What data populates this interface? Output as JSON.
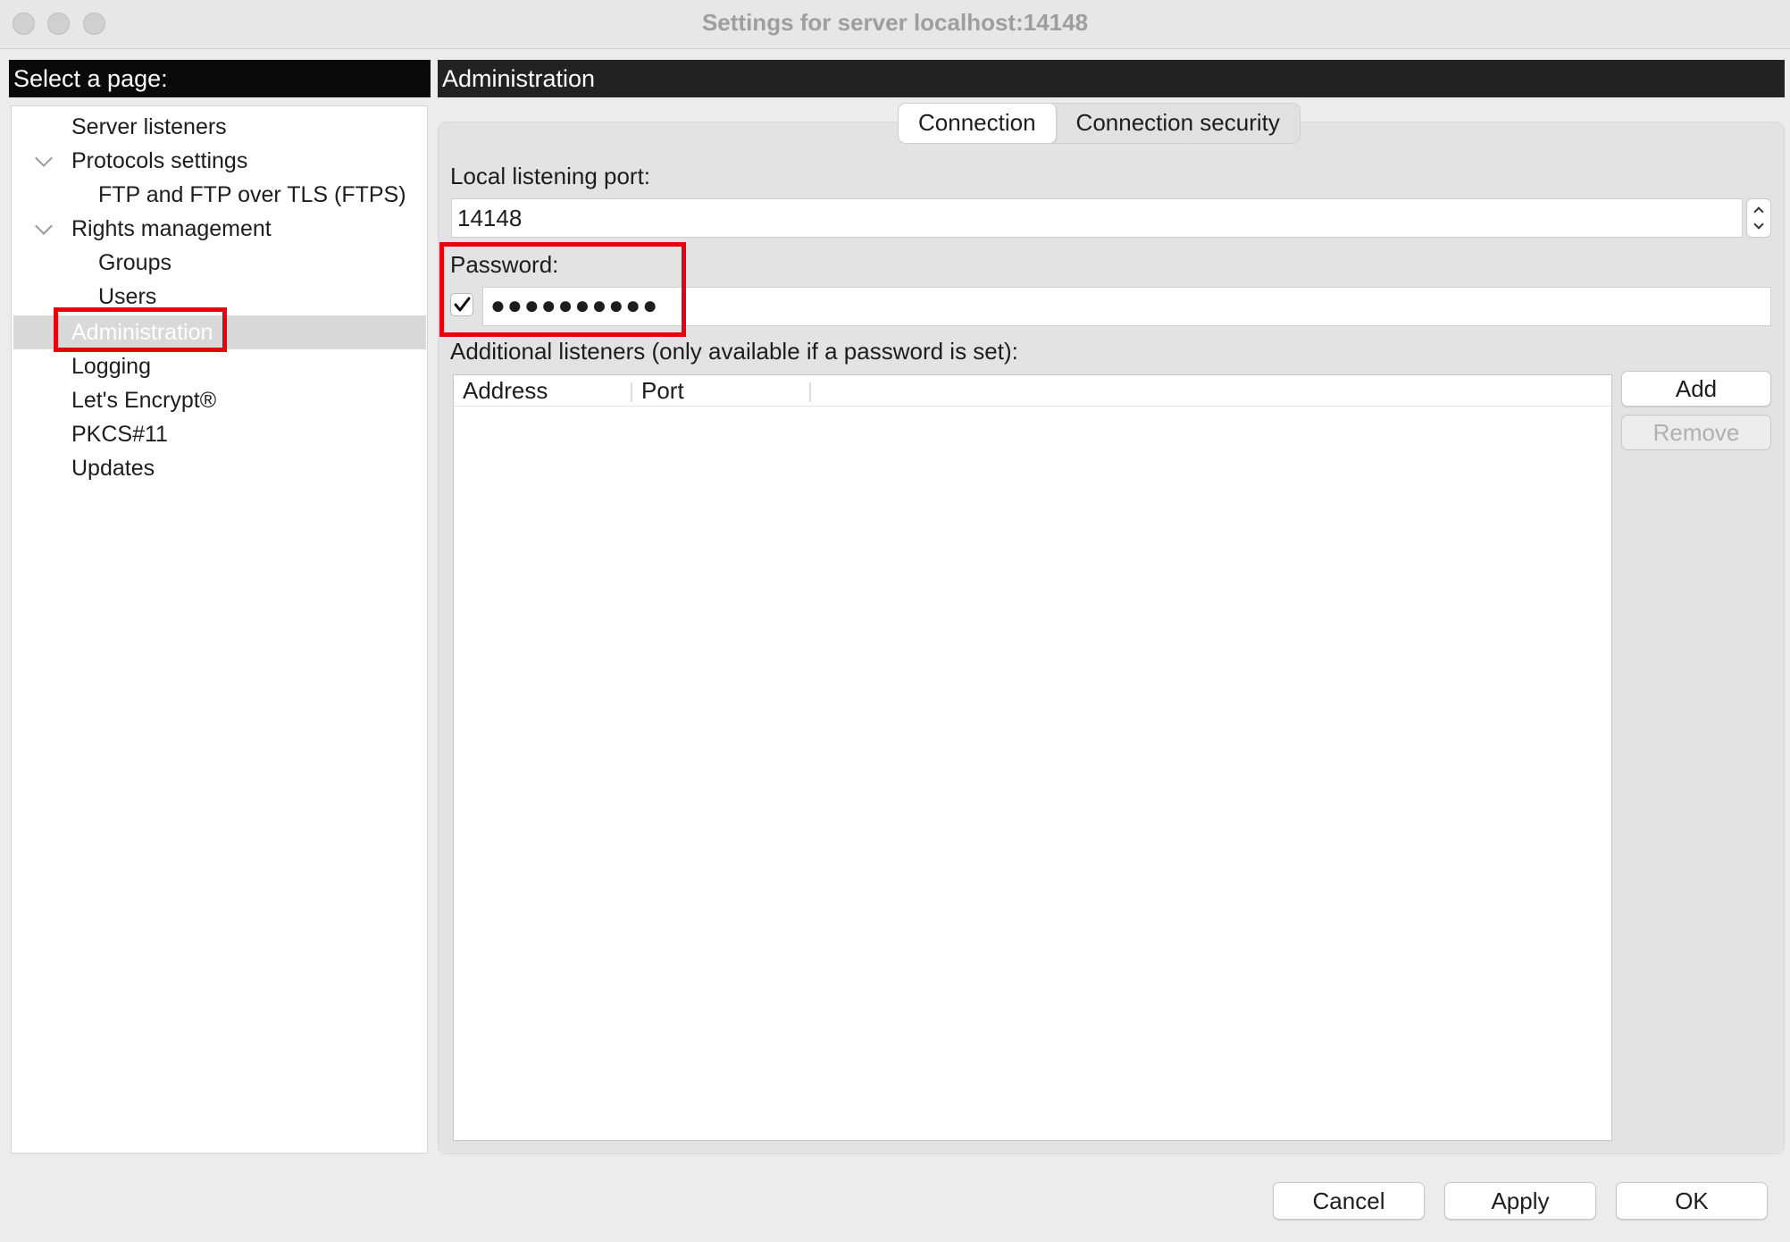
{
  "window": {
    "title": "Settings for server localhost:14148"
  },
  "left": {
    "header": "Select a page:",
    "tree": {
      "server_listeners": "Server listeners",
      "protocols_settings": "Protocols settings",
      "ftp_ftps": "FTP and FTP over TLS (FTPS)",
      "rights_management": "Rights management",
      "groups": "Groups",
      "users": "Users",
      "administration": "Administration",
      "logging": "Logging",
      "lets_encrypt": "Let's Encrypt®",
      "pkcs11": "PKCS#11",
      "updates": "Updates"
    }
  },
  "main": {
    "header": "Administration",
    "tabs": {
      "connection": "Connection",
      "connection_security": "Connection security"
    },
    "port_label": "Local listening port:",
    "port_value": "14148",
    "password_label": "Password:",
    "password_checked": true,
    "password_mask": "●●●●●●●●●●",
    "listeners_label": "Additional listeners (only available if a password is set):",
    "columns": {
      "address": "Address",
      "port": "Port"
    },
    "add_button": "Add",
    "remove_button": "Remove"
  },
  "footer": {
    "cancel": "Cancel",
    "apply": "Apply",
    "ok": "OK"
  },
  "colors": {
    "highlight_red": "#e8000b",
    "selected_row": "#d9d9d9",
    "header_bg": "#0a0a0a"
  }
}
